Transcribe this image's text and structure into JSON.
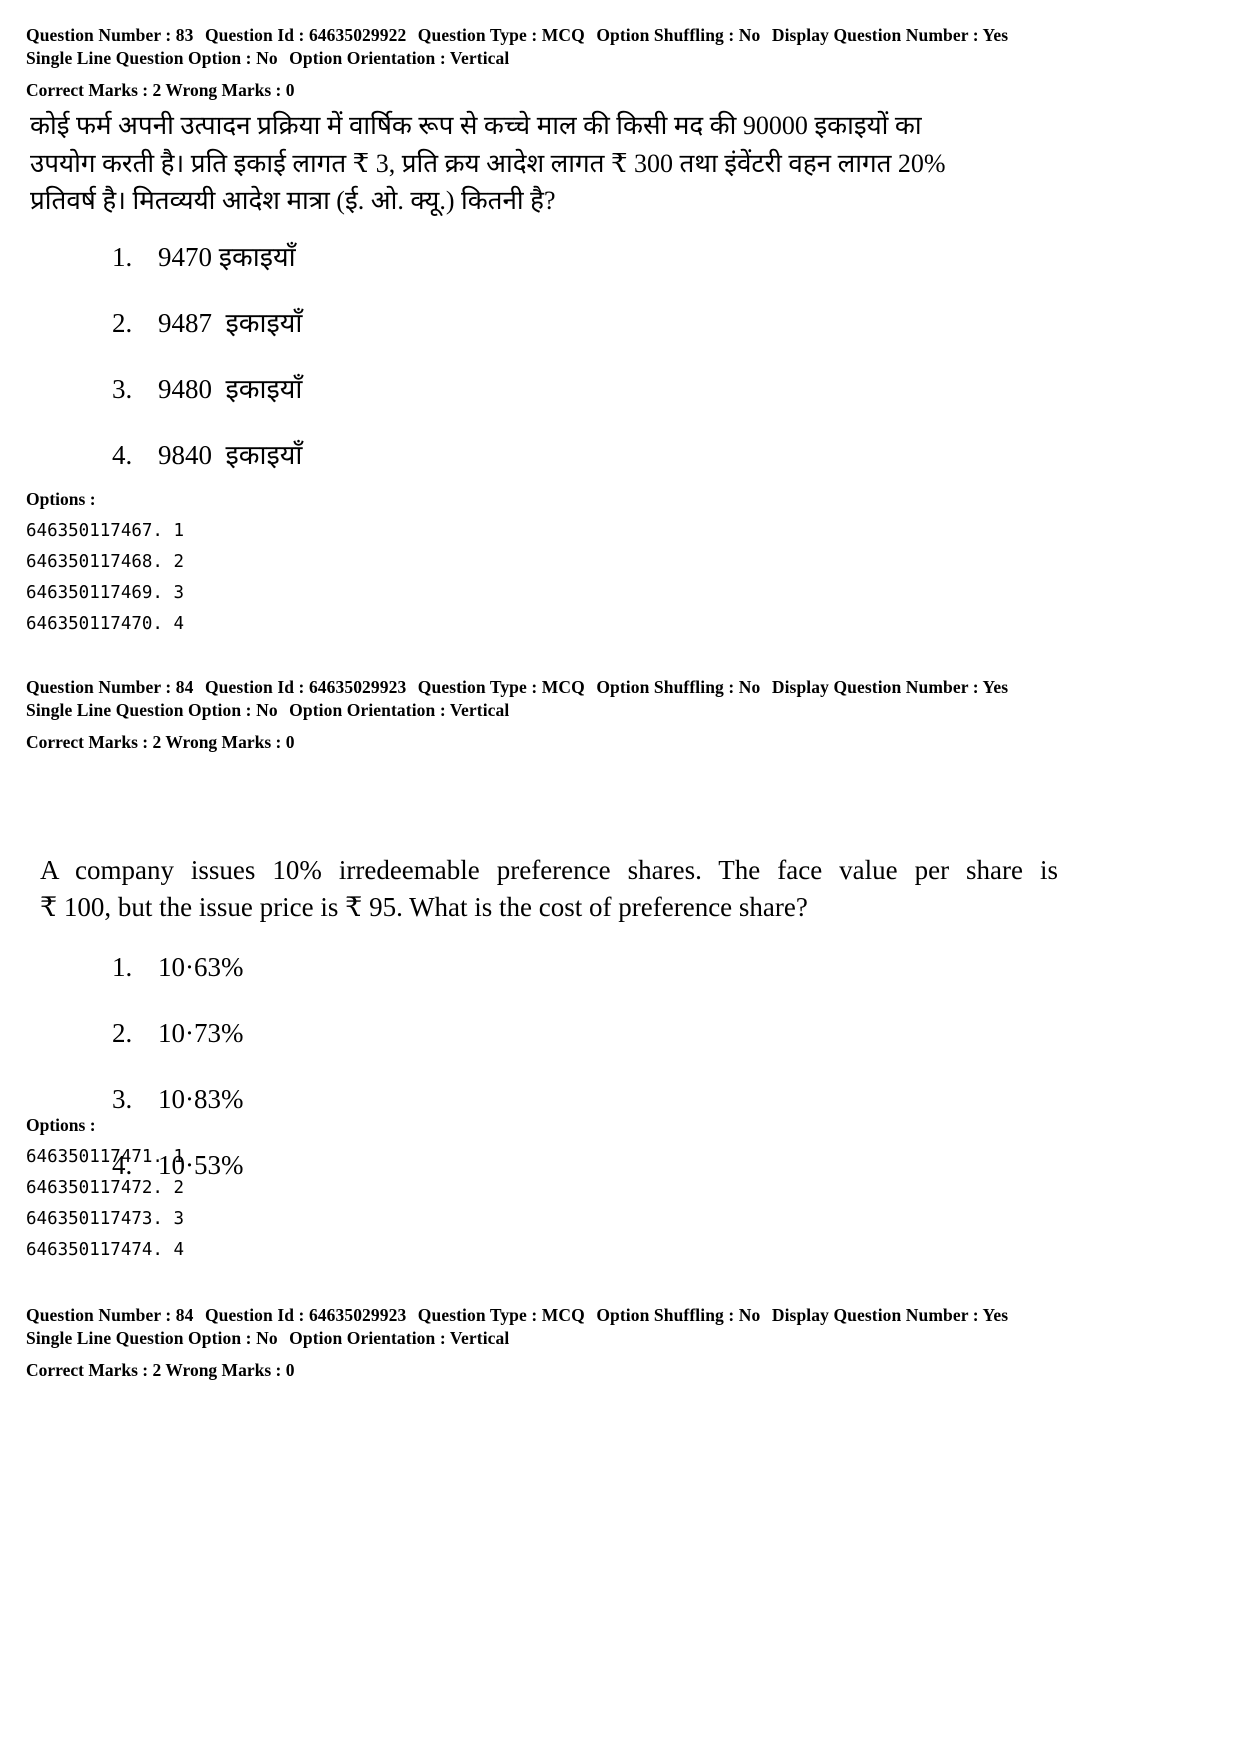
{
  "document": {
    "type": "exam-question-paper-scan"
  },
  "questions": [
    {
      "meta": {
        "question_number_label": "Question Number :",
        "question_number": "83",
        "question_id_label": "Question Id :",
        "question_id": "64635029922",
        "question_type_label": "Question Type :",
        "question_type": "MCQ",
        "option_shuffling_label": "Option Shuffling :",
        "option_shuffling": "No",
        "display_question_number_label": "Display Question Number :",
        "display_question_number": "Yes",
        "single_line_question_option_label": "Single Line Question Option :",
        "single_line_question_option": "No",
        "option_orientation_label": "Option Orientation :",
        "option_orientation": "Vertical",
        "correct_marks_label": "Correct Marks :",
        "correct_marks": "2",
        "wrong_marks_label": "Wrong Marks :",
        "wrong_marks": "0"
      },
      "stem_lines": [
        "कोई फर्म अपनी उत्पादन प्रक्रिया में वार्षिक रूप से कच्चे माल की किसी मद की 90000 इकाइयों का",
        "उपयोग करती है। प्रति इकाई लागत ₹ 3, प्रति क्रय आदेश लागत ₹ 300 तथा इंवेंटरी वहन लागत 20%",
        "प्रतिवर्ष है। मितव्ययी आदेश मात्रा (ई. ओ. क्यू.) कितनी है?"
      ],
      "choices": [
        {
          "num": "1.",
          "text": "9470 इकाइयाँ"
        },
        {
          "num": "2.",
          "text": "9487  इकाइयाँ"
        },
        {
          "num": "3.",
          "text": "9480  इकाइयाँ"
        },
        {
          "num": "4.",
          "text": "9840  इकाइयाँ"
        }
      ],
      "options_heading": "Options :",
      "option_ids": [
        "646350117467. 1",
        "646350117468. 2",
        "646350117469. 3",
        "646350117470. 4"
      ]
    },
    {
      "meta": {
        "question_number_label": "Question Number :",
        "question_number": "84",
        "question_id_label": "Question Id :",
        "question_id": "64635029923",
        "question_type_label": "Question Type :",
        "question_type": "MCQ",
        "option_shuffling_label": "Option Shuffling :",
        "option_shuffling": "No",
        "display_question_number_label": "Display Question Number :",
        "display_question_number": "Yes",
        "single_line_question_option_label": "Single Line Question Option :",
        "single_line_question_option": "No",
        "option_orientation_label": "Option Orientation :",
        "option_orientation": "Vertical",
        "correct_marks_label": "Correct Marks :",
        "correct_marks": "2",
        "wrong_marks_label": "Wrong Marks :",
        "wrong_marks": "0"
      },
      "stem_lines": [
        "A company issues 10% irredeemable preference shares. The face value per share is",
        "₹ 100, but the issue price is ₹ 95. What is the cost of preference share?"
      ],
      "choices": [
        {
          "num": "1.",
          "text": "10·63%"
        },
        {
          "num": "2.",
          "text": "10·73%"
        },
        {
          "num": "3.",
          "text": "10·83%"
        },
        {
          "num": "4.",
          "text": "10·53%"
        }
      ],
      "options_heading": "Options :",
      "option_ids": [
        "646350117471. 1",
        "646350117472. 2",
        "646350117473. 3",
        "646350117474. 4"
      ]
    },
    {
      "meta": {
        "question_number_label": "Question Number :",
        "question_number": "84",
        "question_id_label": "Question Id :",
        "question_id": "64635029923",
        "question_type_label": "Question Type :",
        "question_type": "MCQ",
        "option_shuffling_label": "Option Shuffling :",
        "option_shuffling": "No",
        "display_question_number_label": "Display Question Number :",
        "display_question_number": "Yes",
        "single_line_question_option_label": "Single Line Question Option :",
        "single_line_question_option": "No",
        "option_orientation_label": "Option Orientation :",
        "option_orientation": "Vertical",
        "correct_marks_label": "Correct Marks :",
        "correct_marks": "2",
        "wrong_marks_label": "Wrong Marks :",
        "wrong_marks": "0"
      },
      "stem_lines": [],
      "choices": [],
      "options_heading": "",
      "option_ids": []
    }
  ]
}
